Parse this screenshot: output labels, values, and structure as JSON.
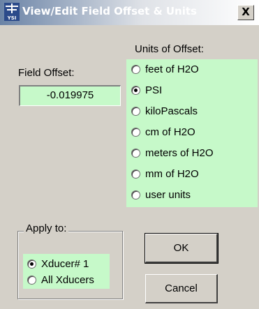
{
  "window": {
    "title": "View/Edit Field Offset & Units",
    "icon_caption": "YSI",
    "close_label": "X"
  },
  "field_offset": {
    "label": "Field Offset:",
    "value": "-0.019975"
  },
  "units": {
    "heading": "Units of Offset:",
    "options": [
      {
        "label": "feet of H2O",
        "checked": false
      },
      {
        "label": "PSI",
        "checked": true
      },
      {
        "label": "kiloPascals",
        "checked": false
      },
      {
        "label": "cm of H2O",
        "checked": false
      },
      {
        "label": "meters of H2O",
        "checked": false
      },
      {
        "label": "mm of H2O",
        "checked": false
      },
      {
        "label": "user units",
        "checked": false
      }
    ]
  },
  "apply_to": {
    "legend": "Apply to:",
    "options": [
      {
        "label": "Xducer# 1",
        "checked": true
      },
      {
        "label": "All Xducers",
        "checked": false
      }
    ]
  },
  "buttons": {
    "ok": "OK",
    "cancel": "Cancel"
  },
  "colors": {
    "panel_green": "#c6f9c9",
    "dialog_face": "#d4d0c8"
  }
}
